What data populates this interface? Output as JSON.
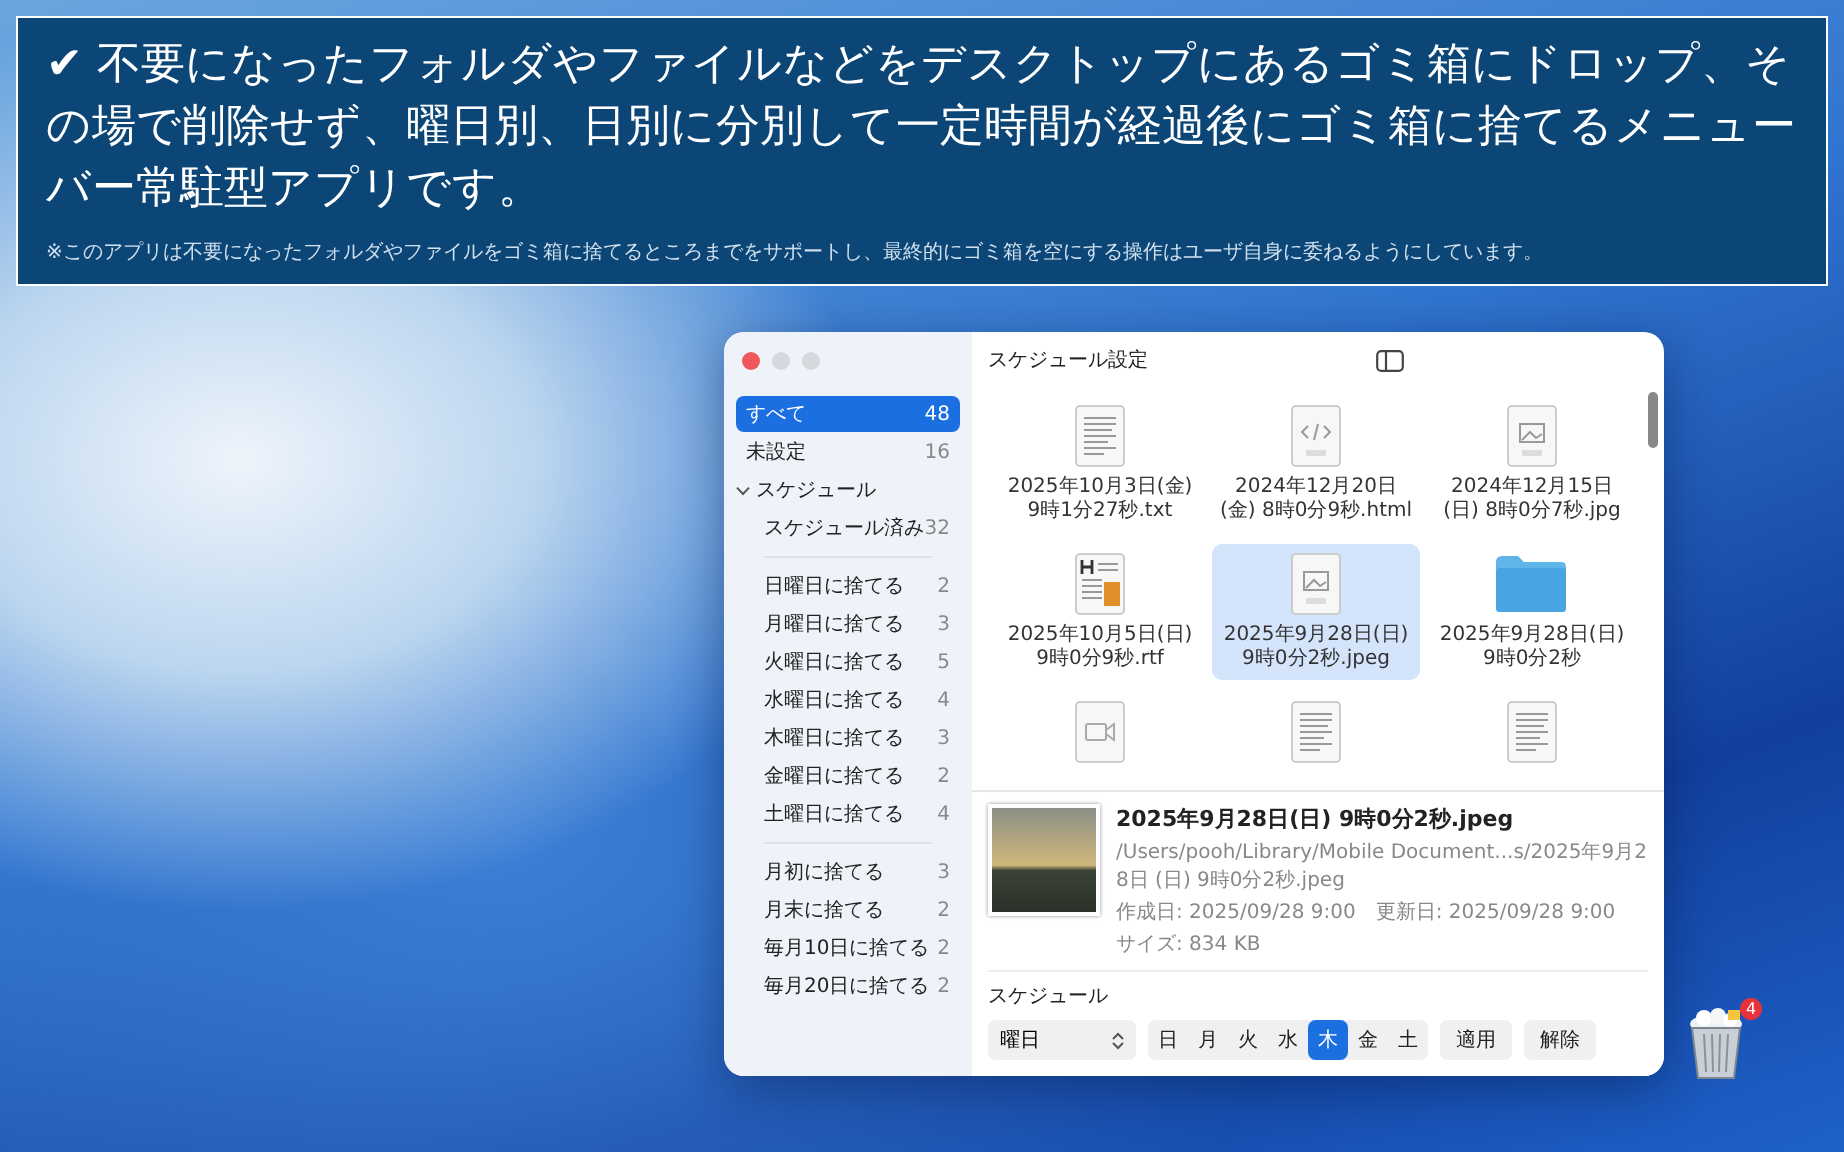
{
  "banner": {
    "headline": "✔ 不要になったフォルダやファイルなどをデスクトップにあるゴミ箱にドロップ、その場で削除せず、曜日別、日別に分別して一定時間が経過後にゴミ箱に捨てるメニューバー常駐型アプリです。",
    "note": "※このアプリは不要になったフォルダやファイルをゴミ箱に捨てるところまでをサポートし、最終的にゴミ箱を空にする操作はユーザ自身に委ねるようにしています。"
  },
  "window": {
    "title": "スケジュール設定"
  },
  "sidebar": {
    "items": [
      {
        "label": "すべて",
        "count": "48",
        "selected": true
      },
      {
        "label": "未設定",
        "count": "16",
        "selected": false
      }
    ],
    "schedule_group": {
      "label": "スケジュール",
      "expanded": true,
      "children": [
        {
          "label": "スケジュール済み",
          "count": "32",
          "selected": false
        }
      ]
    },
    "weekday_items": [
      {
        "label": "日曜日に捨てる",
        "count": "2",
        "selected": false
      },
      {
        "label": "月曜日に捨てる",
        "count": "3",
        "selected": false
      },
      {
        "label": "火曜日に捨てる",
        "count": "5",
        "selected": false
      },
      {
        "label": "水曜日に捨てる",
        "count": "4",
        "selected": false
      },
      {
        "label": "木曜日に捨てる",
        "count": "3",
        "selected": false
      },
      {
        "label": "金曜日に捨てる",
        "count": "2",
        "selected": false
      },
      {
        "label": "土曜日に捨てる",
        "count": "4",
        "selected": false
      }
    ],
    "monthly_items": [
      {
        "label": "月初に捨てる",
        "count": "3",
        "selected": false
      },
      {
        "label": "月末に捨てる",
        "count": "2",
        "selected": false
      },
      {
        "label": "毎月10日に捨てる",
        "count": "2",
        "selected": false
      },
      {
        "label": "毎月20日に捨てる",
        "count": "2",
        "selected": false
      }
    ]
  },
  "files": [
    {
      "name": "2025年10月3日(金) 9時1分27秒.txt",
      "kind": "text",
      "selected": false
    },
    {
      "name": "2024年12月20日(金) 8時0分9秒.html",
      "kind": "html",
      "selected": false
    },
    {
      "name": "2024年12月15日(日) 8時0分7秒.jpg",
      "kind": "image",
      "selected": false
    },
    {
      "name": "2025年10月5日(日) 9時0分9秒.rtf",
      "kind": "rtf",
      "selected": false
    },
    {
      "name": "2025年9月28日(日) 9時0分2秒.jpeg",
      "kind": "image",
      "selected": true
    },
    {
      "name": "2025年9月28日(日) 9時0分2秒",
      "kind": "folder",
      "selected": false
    },
    {
      "kind": "video",
      "selected": false
    },
    {
      "kind": "text",
      "selected": false
    },
    {
      "kind": "text",
      "selected": false
    }
  ],
  "detail": {
    "title": "2025年9月28日(日) 9時0分2秒.jpeg",
    "path": "/Users/pooh/Library/Mobile Document...s/2025年9月28日 (日) 9時0分2秒.jpeg",
    "created": "作成日: 2025/09/28 9:00",
    "modified": "更新日: 2025/09/28 9:00",
    "size": "サイズ: 834 KB"
  },
  "schedule": {
    "label": "スケジュール",
    "dropdown": "曜日",
    "days": [
      {
        "label": "日",
        "selected": false
      },
      {
        "label": "月",
        "selected": false
      },
      {
        "label": "火",
        "selected": false
      },
      {
        "label": "水",
        "selected": false
      },
      {
        "label": "木",
        "selected": true
      },
      {
        "label": "金",
        "selected": false
      },
      {
        "label": "土",
        "selected": false
      }
    ],
    "buttons": [
      "適用",
      "解除"
    ]
  },
  "trash": {
    "badge": "4"
  }
}
